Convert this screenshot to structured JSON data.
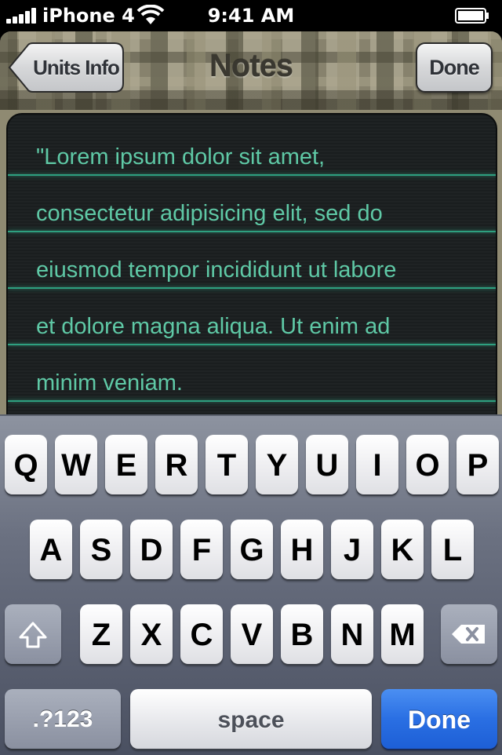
{
  "status_bar": {
    "carrier": "iPhone 4",
    "time": "9:41 AM",
    "icons": [
      "signal-icon",
      "wifi-icon",
      "battery-icon"
    ]
  },
  "nav": {
    "title": "Notes",
    "back_label": "Units Info",
    "done_label": "Done"
  },
  "notes": {
    "lines": [
      "\"Lorem ipsum dolor sit amet,",
      "consectetur adipisicing elit, sed do",
      "eiusmod tempor incididunt ut labore",
      "et dolore magna aliqua. Ut enim ad",
      "minim veniam."
    ],
    "text_color": "#5fc9a6",
    "line_color": "#2ea080"
  },
  "keyboard": {
    "row1": [
      "Q",
      "W",
      "E",
      "R",
      "T",
      "Y",
      "U",
      "I",
      "O",
      "P"
    ],
    "row2": [
      "A",
      "S",
      "D",
      "F",
      "G",
      "H",
      "J",
      "K",
      "L"
    ],
    "row3": [
      "Z",
      "X",
      "C",
      "V",
      "B",
      "N",
      "M"
    ],
    "numbers_label": ".?123",
    "space_label": "space",
    "done_label": "Done",
    "shift_icon": "shift-icon",
    "delete_icon": "delete-icon",
    "accent": "#2a6fe3"
  }
}
